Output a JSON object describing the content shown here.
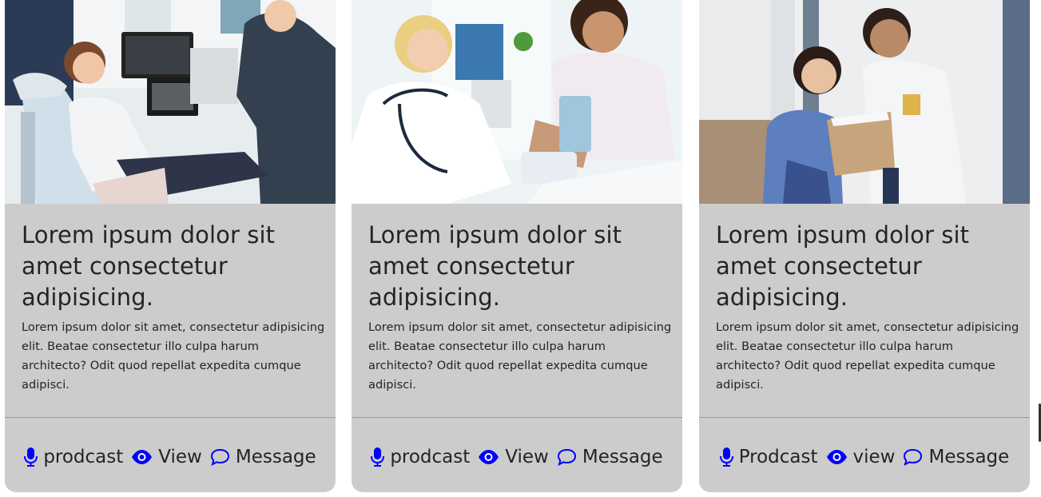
{
  "theme": {
    "card_bg": "#cccccc",
    "icon_color": "#0000ff",
    "text_color": "#212529"
  },
  "cards": [
    {
      "image_alt": "Dentist showing x-ray to young patient",
      "title": "Lorem ipsum dolor sit amet consectetur adipisicing.",
      "text": "Lorem ipsum dolor sit amet, consectetur adipisicing elit. Beatae consectetur illo culpa harum architecto? Odit quod repellat expedita cumque adipisci.",
      "links": [
        {
          "icon": "microphone-icon",
          "label": "prodcast"
        },
        {
          "icon": "eye-icon",
          "label": "View"
        },
        {
          "icon": "chat-bubble-icon",
          "label": "Message"
        }
      ]
    },
    {
      "image_alt": "Doctor measuring patient blood pressure",
      "title": "Lorem ipsum dolor sit amet consectetur adipisicing.",
      "text": "Lorem ipsum dolor sit amet, consectetur adipisicing elit. Beatae consectetur illo culpa harum architecto? Odit quod repellat expedita cumque adipisci.",
      "links": [
        {
          "icon": "microphone-icon",
          "label": "prodcast"
        },
        {
          "icon": "eye-icon",
          "label": "View"
        },
        {
          "icon": "chat-bubble-icon",
          "label": "Message"
        }
      ]
    },
    {
      "image_alt": "Doctor and nurse reviewing clipboard in hospital hallway",
      "title": "Lorem ipsum dolor sit amet consectetur adipisicing.",
      "text": "Lorem ipsum dolor sit amet, consectetur adipisicing elit. Beatae consectetur illo culpa harum architecto? Odit quod repellat expedita cumque adipisci.",
      "links": [
        {
          "icon": "microphone-icon",
          "label": "Prodcast"
        },
        {
          "icon": "eye-icon",
          "label": "view"
        },
        {
          "icon": "chat-bubble-icon",
          "label": "Message"
        }
      ]
    }
  ]
}
